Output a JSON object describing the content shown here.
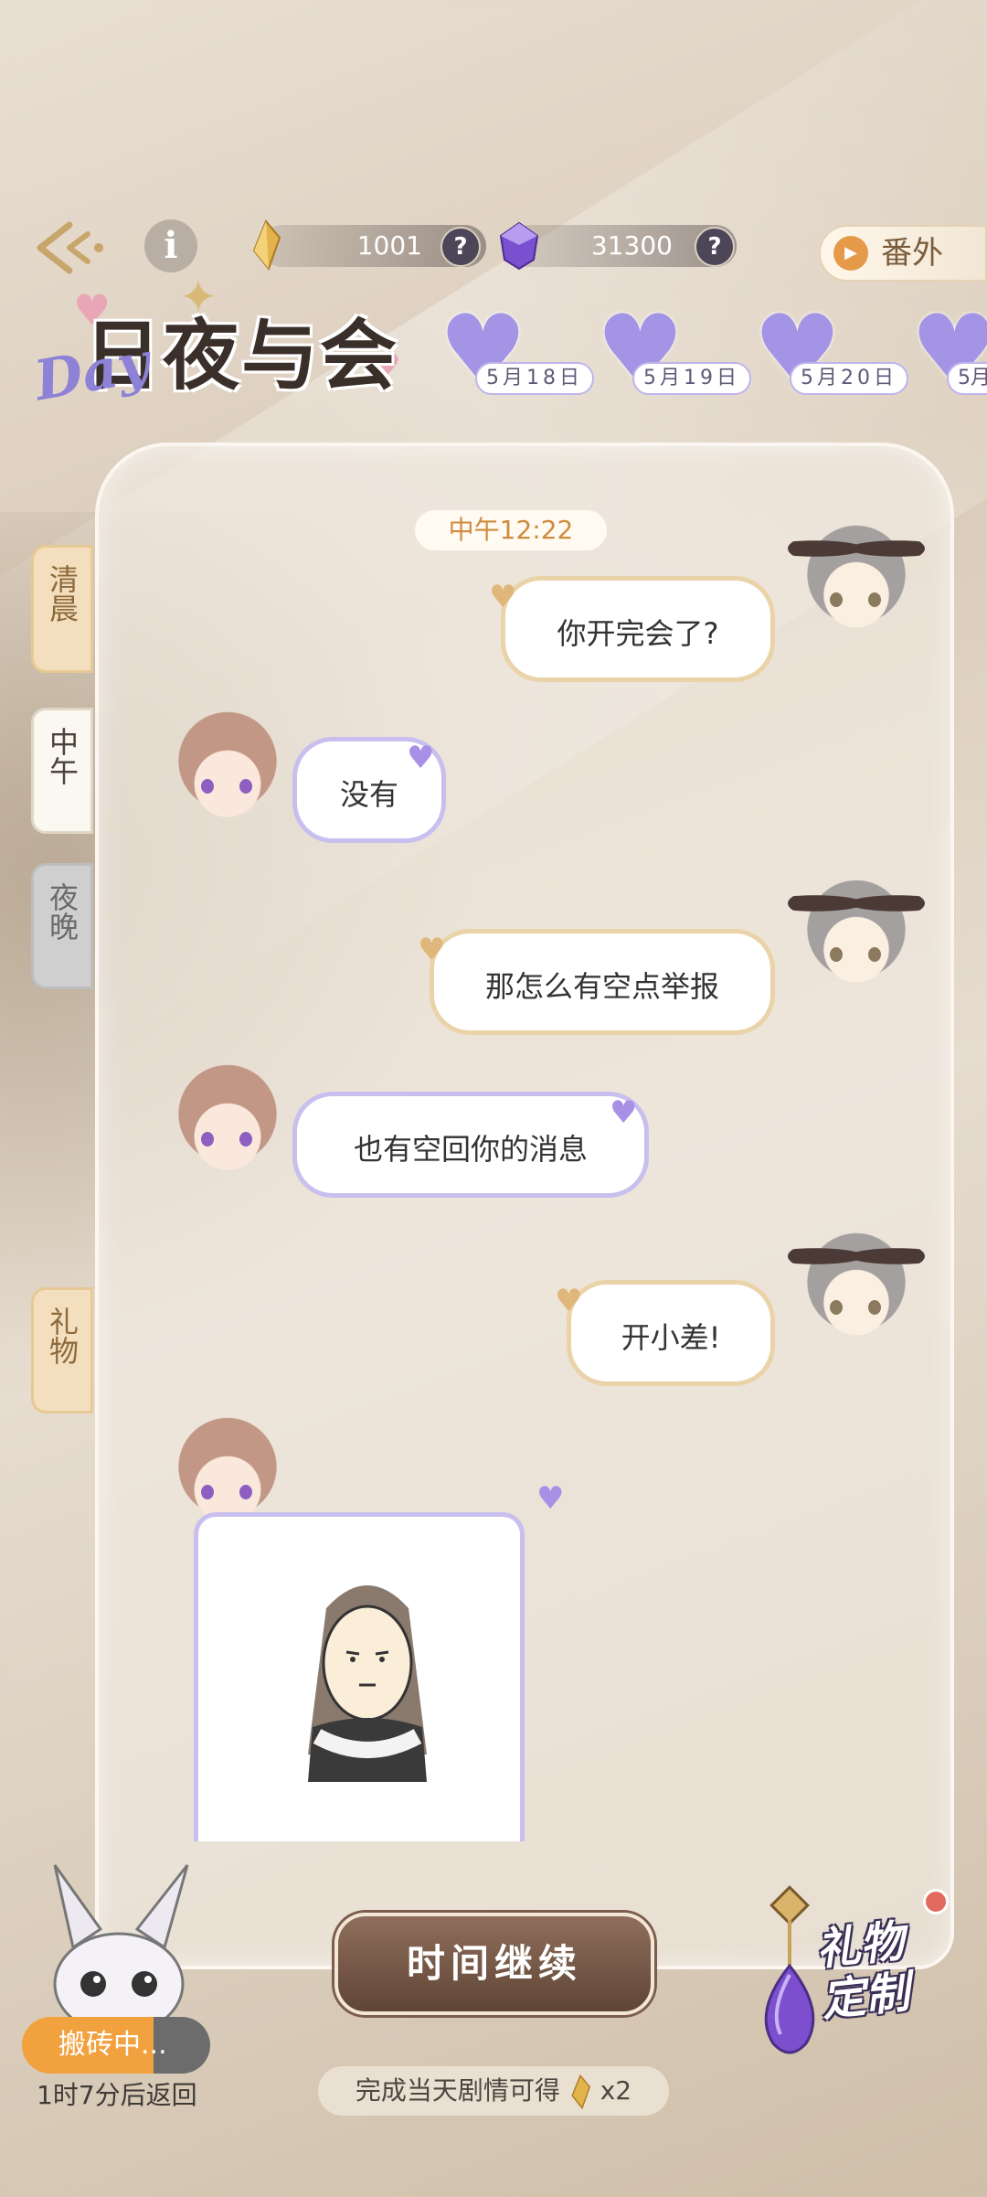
{
  "topbar": {
    "gold_amount": "1001",
    "gem_amount": "31300",
    "help_symbol": "?",
    "extra_label": "番外",
    "back_icon": "back-arrow-icon",
    "info_icon": "info-icon"
  },
  "logo": {
    "day_word": "Day",
    "title": "日夜与会"
  },
  "dates": [
    {
      "label": "5月18日"
    },
    {
      "label": "5月19日"
    },
    {
      "label": "5月20日"
    },
    {
      "label": "5月"
    }
  ],
  "side_tabs": {
    "morning": "清晨",
    "noon": "中午",
    "night": "夜晚",
    "gift": "礼物"
  },
  "chat": {
    "time": "中午12:22",
    "messages": [
      {
        "from": "her",
        "text": "你开完会了?"
      },
      {
        "from": "him",
        "text": "没有"
      },
      {
        "from": "her",
        "text": "那怎么有空点举报"
      },
      {
        "from": "him",
        "text": "也有空回你的消息"
      },
      {
        "from": "her",
        "text": "开小差!"
      }
    ]
  },
  "bottom": {
    "status": "搬砖中...",
    "status_sub": "1时7分后返回",
    "continue_label": "时间继续",
    "reward_prefix": "完成当天剧情可得",
    "reward_suffix": "x2",
    "gift_custom_line1": "礼物",
    "gift_custom_line2": "定制"
  },
  "colors": {
    "her_border": "#ead3a8",
    "him_border": "#c8bfef",
    "accent_gold": "#d08a3c",
    "accent_purple": "#a394e6"
  }
}
